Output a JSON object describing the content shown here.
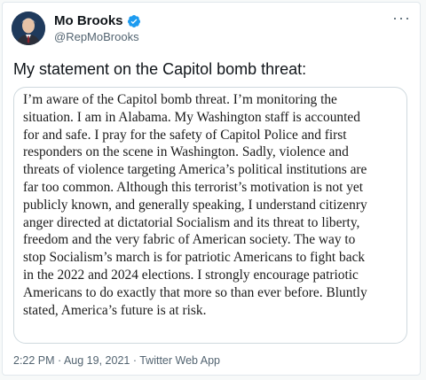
{
  "author": {
    "display_name": "Mo Brooks",
    "handle": "@RepMoBrooks",
    "verified_icon": "verified-badge-icon",
    "avatar_icon": "avatar"
  },
  "menu_icon": "more-options-icon",
  "tweet_text": "My statement on the Capitol bomb threat:",
  "statement_lines": [
    "I’m aware of the Capitol bomb threat.  I’m monitoring the",
    "situation. I am in Alabama.  My Washington staff is accounted",
    "for and safe. I pray for the safety of Capitol Police and first",
    "responders on the scene in Washington. Sadly, violence and",
    "threats of violence targeting America’s political institutions are",
    "far too common. Although this terrorist’s motivation is not yet",
    "publicly known, and generally speaking, I understand citizenry",
    "anger directed at dictatorial Socialism and its threat to liberty,",
    "freedom and the very fabric of American society.  The way to",
    "stop Socialism’s march is for patriotic Americans to fight back",
    "in the 2022 and 2024 elections.  I strongly encourage patriotic",
    "Americans to do exactly that more so than ever before.  Bluntly",
    "stated, America’s future is at risk."
  ],
  "timestamp": "2:22 PM · Aug 19, 2021 · Twitter Web App",
  "colors": {
    "verified_blue": "#1d9bf0",
    "text": "#0f1419",
    "secondary": "#536471"
  }
}
